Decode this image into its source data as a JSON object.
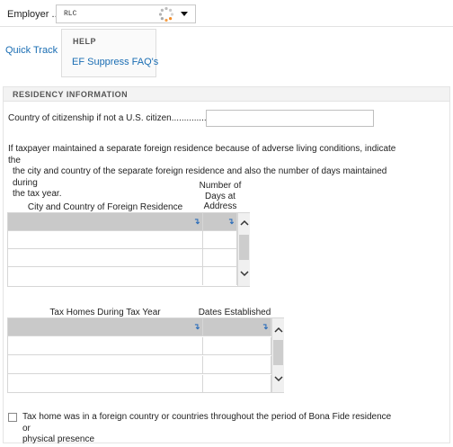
{
  "employer": {
    "label": "Employer ...",
    "value": "RLC"
  },
  "nav": {
    "quick_track": "Quick Track"
  },
  "help": {
    "title": "HELP",
    "link": "EF Suppress FAQ's"
  },
  "section": {
    "title": "RESIDENCY INFORMATION"
  },
  "citizenship": {
    "label": "Country of citizenship if not a U.S. citizen.................",
    "value": ""
  },
  "paragraph": {
    "line1": "If taxpayer maintained a separate foreign residence because of adverse living conditions, indicate the",
    "line2": "the city and country of the separate foreign residence and also the number of days maintained during",
    "line3": "the tax year."
  },
  "residence_grid": {
    "col1_header": "City and Country of Foreign Residence",
    "col2_header_lines": [
      "Number of",
      "Days at",
      "Address"
    ],
    "rows": [
      [
        "",
        ""
      ],
      [
        "",
        ""
      ],
      [
        "",
        ""
      ],
      [
        "",
        ""
      ]
    ]
  },
  "tax_homes_grid": {
    "col1_header": "Tax Homes During Tax Year",
    "col2_header": "Dates Established",
    "rows": [
      [
        "",
        ""
      ],
      [
        "",
        ""
      ],
      [
        "",
        ""
      ],
      [
        "",
        ""
      ]
    ]
  },
  "bona_fide": {
    "checked": false,
    "line1": "Tax home was in a foreign country or countries throughout the period of Bona Fide residence or",
    "line2": "physical presence"
  },
  "icons": {
    "enter": "↴",
    "spinner": "spinner-icon",
    "dropdown": "chevron-down-icon"
  }
}
